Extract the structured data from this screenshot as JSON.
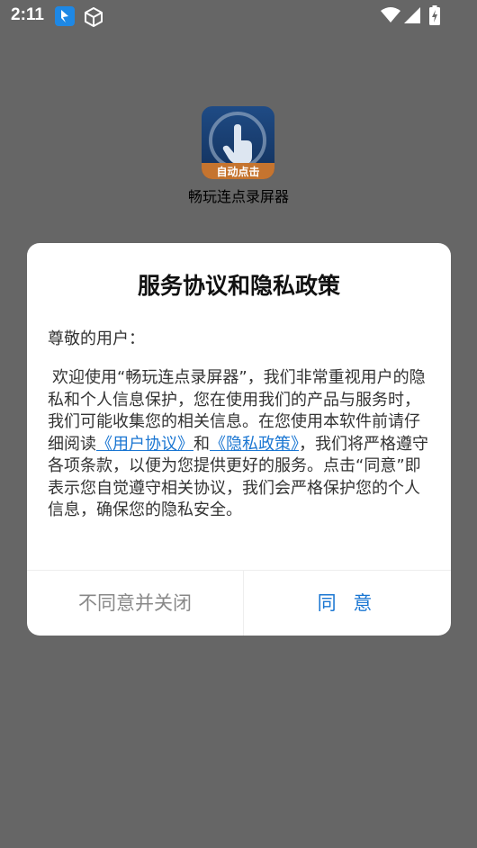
{
  "status_bar": {
    "time": "2:11",
    "icons": [
      "app-notification-icon",
      "cube-icon",
      "wifi-icon",
      "signal-icon",
      "battery-charging-icon"
    ]
  },
  "app": {
    "icon_badge": "自动点击",
    "name": "畅玩连点录屏器"
  },
  "dialog": {
    "title": "服务协议和隐私政策",
    "greeting": "尊敬的用户：",
    "body_part1": "欢迎使用“畅玩连点录屏器”，我们非常重视用户的隐私和个人信息保护，您在使用我们的产品与服务时，我们可能收集您的相关信息。在您使用本软件前请仔细阅读",
    "link_user_agreement": "《用户协议》",
    "body_and": "和",
    "link_privacy_policy": "《隐私政策》",
    "body_part2": "，我们将严格遵守各项条款，以便为您提供更好的服务。点击“同意”即表示您自觉遵守相关协议，我们会严格保护您的个人信息，确保您的隐私安全。",
    "decline_label": "不同意并关闭",
    "agree_label": "同 意"
  },
  "colors": {
    "overlay": "#666666",
    "link": "#1a76d2",
    "decline_text": "#888888"
  }
}
